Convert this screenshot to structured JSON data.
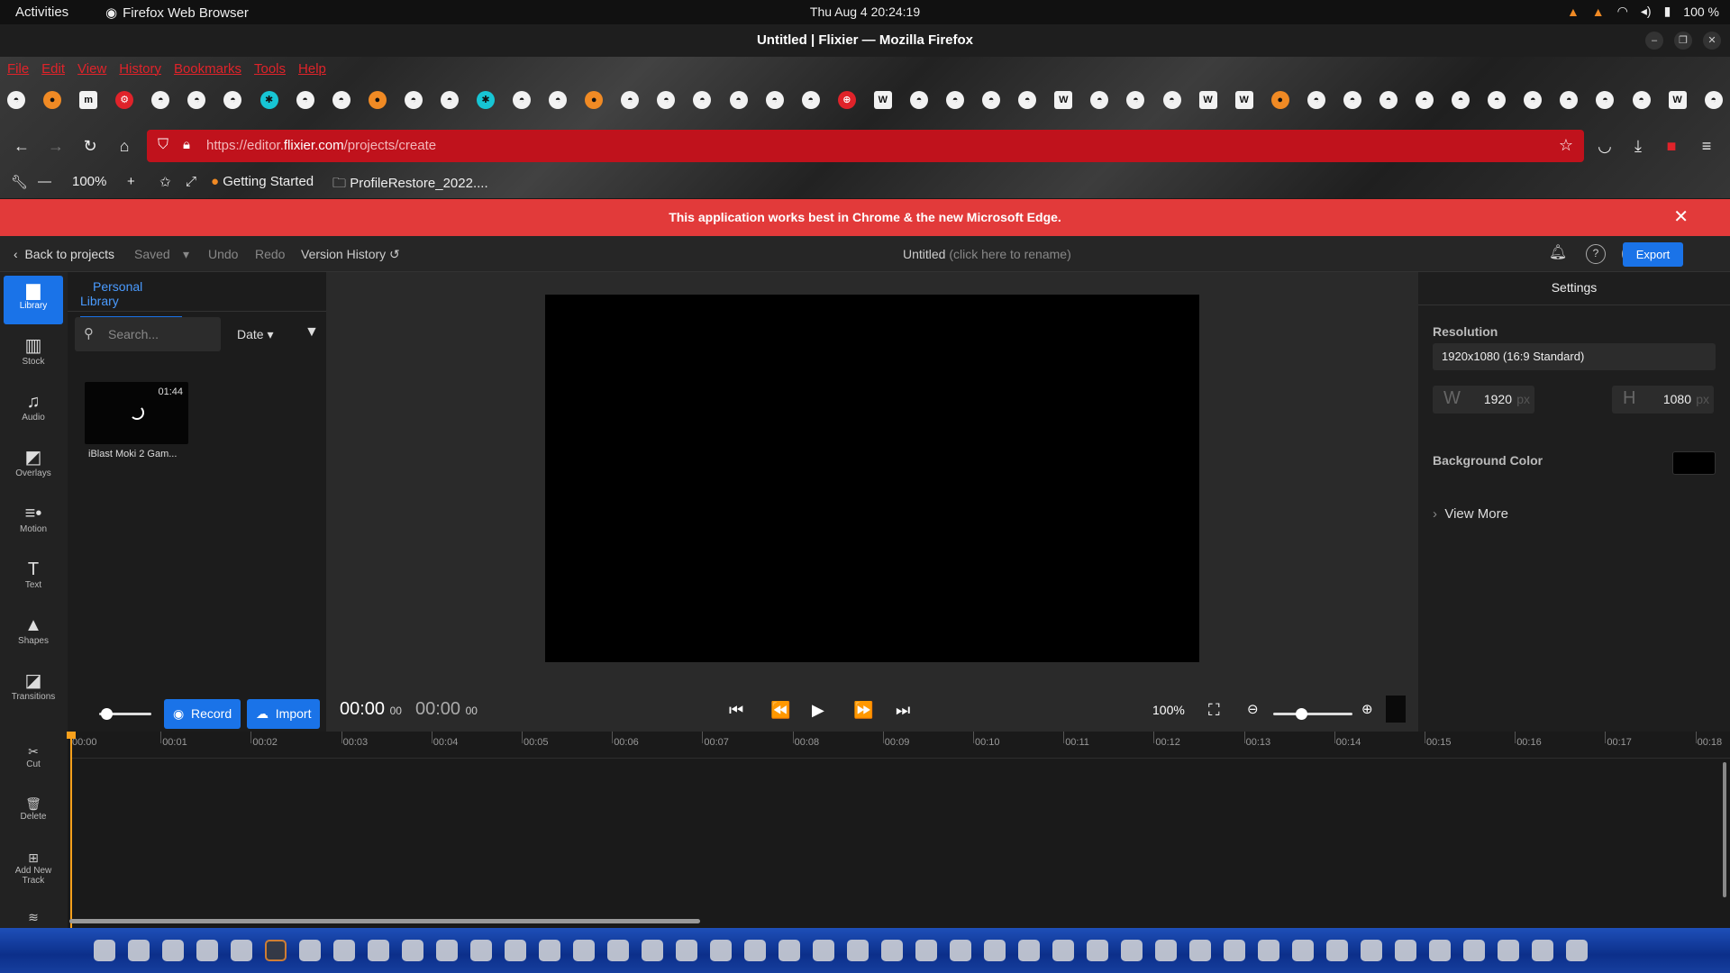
{
  "os": {
    "activities": "Activities",
    "app_name": "Firefox Web Browser",
    "clock": "Thu Aug 4  20:24:19",
    "battery": "100 %"
  },
  "window": {
    "title": "Untitled | Flixier — Mozilla Firefox"
  },
  "menu": [
    "File",
    "Edit",
    "View",
    "History",
    "Bookmarks",
    "Tools",
    "Help"
  ],
  "bookmark_icons": [
    "github",
    "firefox",
    "m",
    "gear",
    "github",
    "github",
    "github",
    "puzzle",
    "github",
    "github",
    "firefox-orange",
    "github",
    "github",
    "puzzle",
    "github",
    "github",
    "firefox",
    "github",
    "github",
    "github",
    "github",
    "github",
    "github",
    "globe",
    "wiki",
    "github",
    "github",
    "github",
    "github",
    "wiki",
    "github",
    "github",
    "github",
    "wiki",
    "wiki",
    "firefox-orange",
    "github",
    "github",
    "github",
    "github",
    "github",
    "github",
    "github",
    "github",
    "github",
    "github",
    "wiki",
    "github"
  ],
  "browser": {
    "url_prefix": "https://editor.",
    "url_domain": "flixier.com",
    "url_path": "/projects/create",
    "zoom": "100%",
    "bookmark_getting_started": "Getting Started",
    "bookmark_folder": "ProfileRestore_2022...."
  },
  "banner": {
    "text": "This application works best in Chrome & the new Microsoft Edge."
  },
  "header": {
    "back": "Back to projects",
    "saved": "Saved",
    "undo": "Undo",
    "redo": "Redo",
    "version_history": "Version History",
    "project_title": "Untitled",
    "rename_hint": "(click here to rename)",
    "export": "Export"
  },
  "rail": [
    {
      "label": "Library",
      "icon": "folder-icon",
      "glyph": "▆",
      "active": true
    },
    {
      "label": "Stock",
      "icon": "books-icon",
      "glyph": "▥"
    },
    {
      "label": "Audio",
      "icon": "music-icon",
      "glyph": "♫"
    },
    {
      "label": "Overlays",
      "icon": "overlay-icon",
      "glyph": "◩"
    },
    {
      "label": "Motion",
      "icon": "motion-icon",
      "glyph": "≡•"
    },
    {
      "label": "Text",
      "icon": "text-icon",
      "glyph": "T"
    },
    {
      "label": "Shapes",
      "icon": "shapes-icon",
      "glyph": "▲"
    },
    {
      "label": "Transitions",
      "icon": "transitions-icon",
      "glyph": "◪"
    }
  ],
  "library": {
    "tab": "Personal Library",
    "search_placeholder": "Search...",
    "sort": "Date",
    "items": [
      {
        "title": "iBlast Moki 2 Gam...",
        "duration": "01:44"
      }
    ]
  },
  "settings": {
    "title": "Settings",
    "resolution_label": "Resolution",
    "resolution_value": "1920x1080 (16:9 Standard)",
    "width_key": "W",
    "width": "1920",
    "height_key": "H",
    "height": "1080",
    "unit": "px",
    "bg_label": "Background Color",
    "bg_color": "#000000",
    "view_more": "View More"
  },
  "player": {
    "record": "Record",
    "import": "Import",
    "current_time": "00:00",
    "current_frames": "00",
    "total_time": "00:00",
    "total_frames": "00",
    "zoom": "100%"
  },
  "timeline": {
    "tools": [
      "Cut",
      "Delete",
      "Add New Track"
    ],
    "ticks": [
      "00:00",
      "00:01",
      "00:02",
      "00:03",
      "00:04",
      "00:05",
      "00:06",
      "00:07",
      "00:08",
      "00:09",
      "00:10",
      "00:11",
      "00:12",
      "00:13",
      "00:14",
      "00:15",
      "00:16",
      "00:17",
      "00:18"
    ]
  },
  "colors": {
    "accent": "#1a73e8",
    "banner": "#e23a3a",
    "urlbar": "#c0121c",
    "playhead": "#f7a01c"
  }
}
